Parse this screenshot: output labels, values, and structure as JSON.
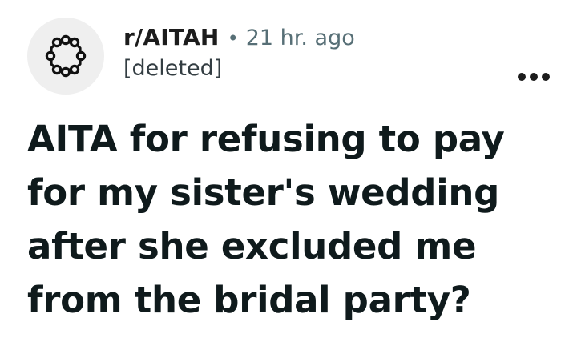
{
  "post": {
    "subreddit": "r/AITAH",
    "separator": "•",
    "time_ago": "21 hr. ago",
    "author": "[deleted]",
    "title": "AITA for refusing to pay for my sister's wedding after she excluded me from the bridal party?"
  },
  "icons": {
    "avatar": "subreddit-ring-icon",
    "overflow": "more-horizontal-icon"
  },
  "colors": {
    "text": "#1c1c1c",
    "muted": "#576f76",
    "avatar_bg": "#efefef"
  }
}
